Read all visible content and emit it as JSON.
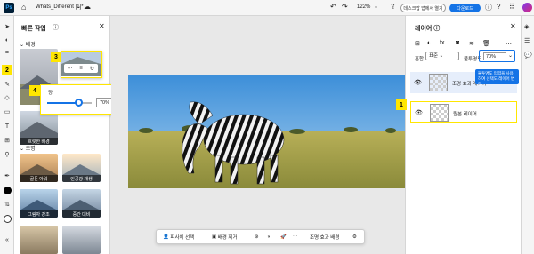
{
  "app": {
    "logo": "Ps",
    "doc_name": "Whats_Different [1]*"
  },
  "topbar": {
    "zoom": "122%",
    "desktop_button": "데스크탑 앱에서 열기",
    "download_button": "다운로드"
  },
  "left_panel": {
    "title": "빠른 작업",
    "section_background": "배경",
    "section_lighting": "조명",
    "background_thumbs": [
      {
        "label": ""
      },
      {
        "label": "흐릿한 배경"
      }
    ],
    "lighting_thumbs": [
      {
        "label": "골든 아워"
      },
      {
        "label": "인공광 재생"
      },
      {
        "label": "그림자 강조"
      },
      {
        "label": "중간 대비"
      }
    ]
  },
  "slider_popup": {
    "label": "양",
    "value": "70%",
    "fraction": 0.7
  },
  "bottombar": {
    "select_subject": "피사체 선택",
    "remove_background": "배경 제거",
    "lighting_bg": "조명 효과 배경"
  },
  "right_panel": {
    "title": "레이어",
    "blend_label": "혼합",
    "blend_value": "표준",
    "opacity_label": "불투명도",
    "opacity_value": "70%",
    "tooltip": "불투명도 입력을 사용하여 선택도 레이어 변경",
    "layers": [
      {
        "name": "조명 효과 레이어"
      },
      {
        "name": "원본 레이어"
      }
    ]
  },
  "badges": [
    "1",
    "2",
    "3",
    "4"
  ]
}
